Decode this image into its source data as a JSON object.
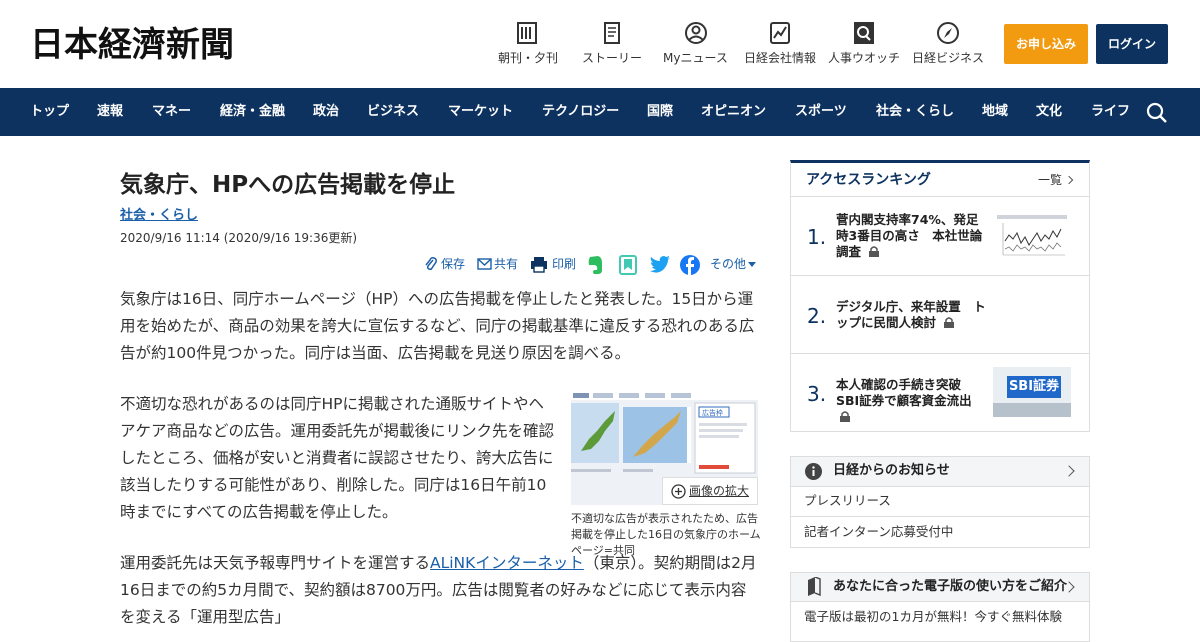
{
  "header": {
    "logo": "日本経濟新聞",
    "nav": [
      {
        "label": "朝刊・夕刊",
        "icon": "newspaper-icon"
      },
      {
        "label": "ストーリー",
        "icon": "story-icon"
      },
      {
        "label": "Myニュース",
        "icon": "person-icon"
      },
      {
        "label": "日経会社情報",
        "icon": "company-chart-icon"
      },
      {
        "label": "人事ウオッチ",
        "icon": "people-search-icon"
      },
      {
        "label": "日経ビジネス",
        "icon": "compass-icon"
      }
    ],
    "subscribe_label": "お申し込み",
    "login_label": "ログイン"
  },
  "navbar": {
    "items": [
      "トップ",
      "速報",
      "マネー",
      "経済・金融",
      "政治",
      "ビジネス",
      "マーケット",
      "テクノロジー",
      "国際",
      "オピニオン",
      "スポーツ",
      "社会・くらし",
      "地域",
      "文化",
      "ライフ"
    ]
  },
  "article": {
    "title": "気象庁、HPへの広告掲載を停止",
    "category": "社会・くらし",
    "date": "2020/9/16 11:14 (2020/9/16 19:36更新)",
    "share": {
      "save": "保存",
      "share": "共有",
      "print": "印刷",
      "other": "その他"
    },
    "p1": "気象庁は16日、同庁ホームページ（HP）への広告掲載を停止したと発表した。15日から運用を始めたが、商品の効果を誇大に宣伝するなど、同庁の掲載基準に違反する恐れのある広告が約100件見つかった。同庁は当面、広告掲載を見送り原因を調べる。",
    "p2": "不適切な恐れがあるのは同庁HPに掲載された通販サイトやヘアケア商品などの広告。運用委託先が掲載後にリンク先を確認したところ、価格が安いと消費者に誤認させたり、誇大広告に該当したりする可能性があり、削除した。同庁は16日午前10時までにすべての広告掲載を停止した。",
    "p3_before": "運用委託先は天気予報専門サイトを運営する",
    "p3_link": "ALiNKインターネット",
    "p3_after": "（東京）。契約期間は2月16日までの約5カ月間で、契約額は8700万円。広告は閲覧者の好みなどに応じて表示内容を変える「運用型広告」",
    "image_zoom": "画像の拡大",
    "image_caption": "不適切な広告が表示されたため、広告掲載を停止した16日の気象庁のホームページ=共同"
  },
  "sidebar": {
    "ranking_title": "アクセスランキング",
    "ranking_more": "一覧",
    "ranking": [
      {
        "rank": "1.",
        "text": "菅内閣支持率74%、発足時3番目の高さ　本社世論調査"
      },
      {
        "rank": "2.",
        "text": "デジタル庁、来年設置　トップに民間人検討"
      },
      {
        "rank": "3.",
        "text": "本人確認の手続き突破　SBI証券で顧客資金流出"
      }
    ],
    "thumb_sbi_text": "SBI証券",
    "notice_title": "日経からのお知らせ",
    "notice_items": [
      "プレスリリース",
      "記者インターン応募受付中"
    ],
    "digital_title": "あなたに合った電子版の使い方をご紹介",
    "digital_items": [
      "電子版は最初の1カ月が無料！今すぐ無料体験"
    ]
  },
  "colors": {
    "navy": "#0d3260",
    "orange": "#f29a10",
    "link": "#1a5fa8"
  }
}
